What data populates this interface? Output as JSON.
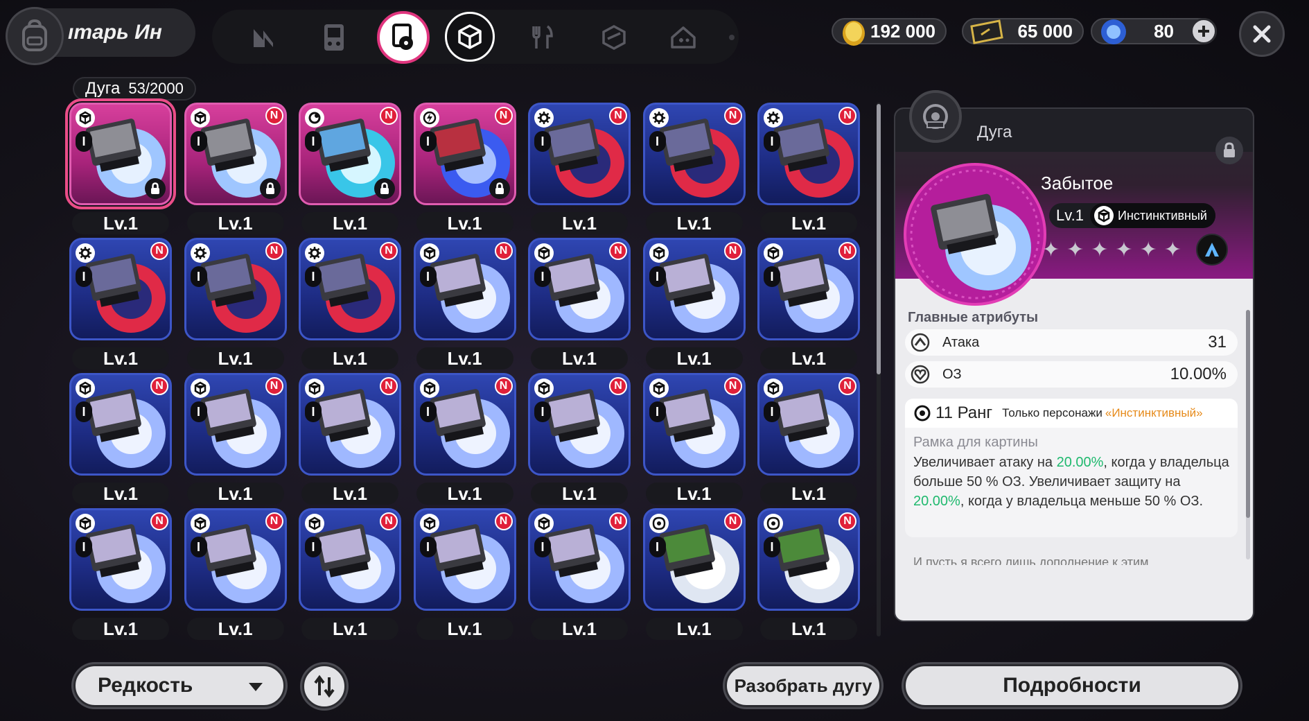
{
  "topbar": {
    "bag_label": "ıтарь Ин",
    "currencies": [
      {
        "name": "gold-coin",
        "value": "192 000"
      },
      {
        "name": "ticket",
        "value": "65 000"
      },
      {
        "name": "blue-crystal",
        "value": "80"
      }
    ]
  },
  "inventory": {
    "label": "Дуга",
    "count": "53/2000"
  },
  "cards": [
    {
      "level": "Lv.1",
      "type": "instinct",
      "art": "forgotten",
      "frame": "pink",
      "lock": true,
      "new": false,
      "selected": true
    },
    {
      "level": "Lv.1",
      "type": "instinct",
      "art": "forgotten",
      "frame": "pink",
      "lock": true,
      "new": true
    },
    {
      "level": "Lv.1",
      "type": "cosmic",
      "art": "ice",
      "frame": "pink",
      "lock": true,
      "new": true
    },
    {
      "level": "Lv.1",
      "type": "storm",
      "art": "storm",
      "frame": "pink",
      "lock": true,
      "new": true
    },
    {
      "level": "Lv.1",
      "type": "gear",
      "art": "red",
      "frame": "blue",
      "new": true
    },
    {
      "level": "Lv.1",
      "type": "gear",
      "art": "red",
      "frame": "blue",
      "new": true
    },
    {
      "level": "Lv.1",
      "type": "gear",
      "art": "red",
      "frame": "blue",
      "new": true
    },
    {
      "level": "Lv.1",
      "type": "gear",
      "art": "red",
      "frame": "blue",
      "new": true
    },
    {
      "level": "Lv.1",
      "type": "gear",
      "art": "red",
      "frame": "blue",
      "new": true
    },
    {
      "level": "Lv.1",
      "type": "gear",
      "art": "red",
      "frame": "blue",
      "new": true
    },
    {
      "level": "Lv.1",
      "type": "instinct",
      "art": "crystal",
      "frame": "blue",
      "new": true
    },
    {
      "level": "Lv.1",
      "type": "instinct",
      "art": "crystal",
      "frame": "blue",
      "new": true
    },
    {
      "level": "Lv.1",
      "type": "instinct",
      "art": "crystal",
      "frame": "blue",
      "new": true
    },
    {
      "level": "Lv.1",
      "type": "instinct",
      "art": "crystal",
      "frame": "blue",
      "new": true
    },
    {
      "level": "Lv.1",
      "type": "instinct",
      "art": "crystal",
      "frame": "blue",
      "new": true
    },
    {
      "level": "Lv.1",
      "type": "instinct",
      "art": "crystal",
      "frame": "blue",
      "new": true
    },
    {
      "level": "Lv.1",
      "type": "instinct",
      "art": "crystal",
      "frame": "blue",
      "new": true
    },
    {
      "level": "Lv.1",
      "type": "instinct",
      "art": "crystal",
      "frame": "blue",
      "new": true
    },
    {
      "level": "Lv.1",
      "type": "instinct",
      "art": "crystal",
      "frame": "blue",
      "new": true
    },
    {
      "level": "Lv.1",
      "type": "instinct",
      "art": "crystal",
      "frame": "blue",
      "new": true
    },
    {
      "level": "Lv.1",
      "type": "instinct",
      "art": "crystal",
      "frame": "blue",
      "new": true
    },
    {
      "level": "Lv.1",
      "type": "instinct",
      "art": "crystal",
      "frame": "blue",
      "new": true
    },
    {
      "level": "Lv.1",
      "type": "instinct",
      "art": "crystal",
      "frame": "blue",
      "new": true
    },
    {
      "level": "Lv.1",
      "type": "instinct",
      "art": "crystal",
      "frame": "blue",
      "new": true
    },
    {
      "level": "Lv.1",
      "type": "instinct",
      "art": "crystal",
      "frame": "blue",
      "new": true
    },
    {
      "level": "Lv.1",
      "type": "instinct",
      "art": "crystal",
      "frame": "blue",
      "new": true
    },
    {
      "level": "Lv.1",
      "type": "swirl",
      "art": "green",
      "frame": "blue",
      "new": true
    },
    {
      "level": "Lv.1",
      "type": "swirl",
      "art": "green",
      "frame": "blue",
      "new": true
    }
  ],
  "detail": {
    "category": "Дуга",
    "name": "Забытое",
    "level": "Lv.1",
    "type_tag": "Инстинктивный",
    "attributes_title": "Главные атрибуты",
    "attributes": [
      {
        "name": "Атака",
        "value": "31",
        "icon": "attack-icon"
      },
      {
        "name": "ОЗ",
        "value": "10.00%",
        "icon": "hp-icon"
      }
    ],
    "passive": {
      "rank": "11 Ранг",
      "only_label": "Только персонажи",
      "only_value": "«Инстинктивный»",
      "name": "Рамка для картины",
      "desc_1": "Увеличивает атаку на ",
      "val_1": "20.00%",
      "desc_2": ", когда у владельца больше 50 % ОЗ. Увеличивает защиту на ",
      "val_2": "20.00%",
      "desc_3": ", когда у владельца меньше 50 % ОЗ."
    },
    "lore": "И пусть я всего лишь дополнение к этим"
  },
  "bottom": {
    "sort_label": "Редкость",
    "disassemble_label": "Разобрать дугу",
    "details_label": "Подробности"
  },
  "colors": {
    "accent_pink": "#e0357e",
    "highlight_green": "#1fb96e",
    "highlight_orange": "#e68a1a",
    "new_badge": "#e0203a"
  }
}
